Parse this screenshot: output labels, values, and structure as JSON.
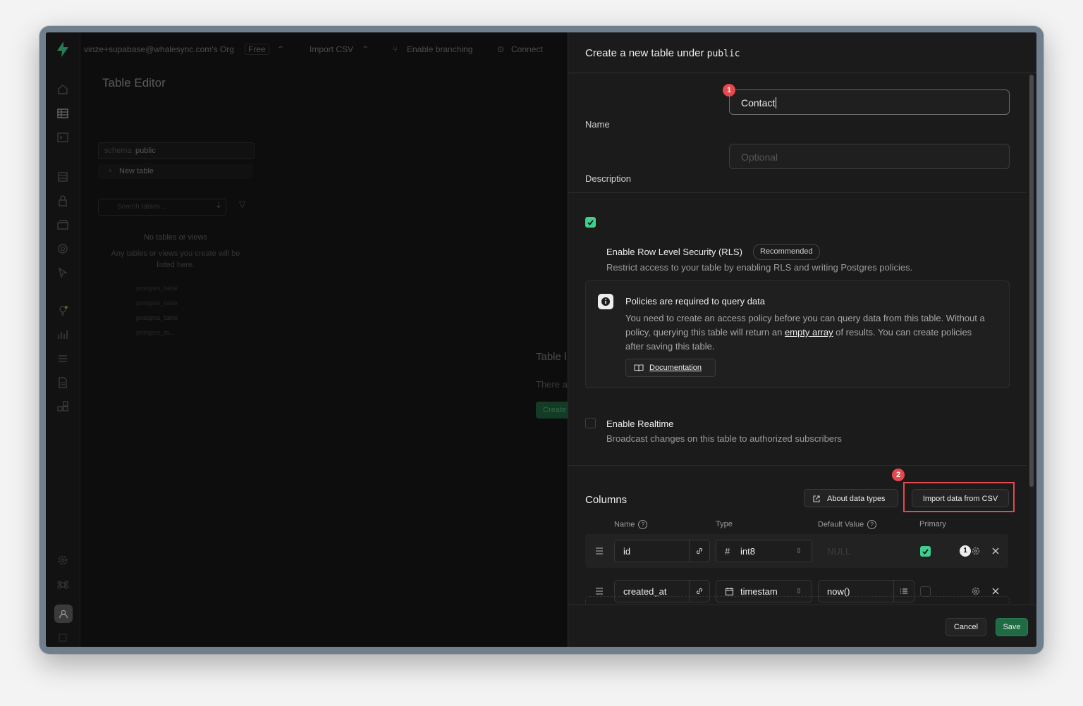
{
  "topbar": {
    "org": "vinze+supabase@whalesync.com's Org",
    "plan": "Free",
    "project": "Import CSV",
    "branching": "Enable branching",
    "connect": "Connect"
  },
  "left": {
    "title": "Table Editor",
    "schema_label": "schema",
    "schema_value": "public",
    "new_table": "New table",
    "search_placeholder": "Search tables...",
    "empty_title": "No tables or views",
    "empty_desc": "Any tables or views you create will be listed here.",
    "ghost_items": [
      "postgres_table",
      "postgres_table",
      "postgres_table",
      "postgres_ta..."
    ]
  },
  "center": {
    "title": "Table l",
    "subtitle": "There a",
    "button": "Create"
  },
  "panel": {
    "title_prefix": "Create a new table under",
    "schema": "public",
    "name_label": "Name",
    "name_value": "Contact",
    "description_label": "Description",
    "description_placeholder": "Optional",
    "rls": {
      "title": "Enable Row Level Security (RLS)",
      "badge": "Recommended",
      "desc": "Restrict access to your table by enabling RLS and writing Postgres policies.",
      "checked": true
    },
    "alert": {
      "title": "Policies are required to query data",
      "body_1": "You need to create an access policy before you can query data from this table. Without a policy, querying this table will return an",
      "link": "empty array",
      "body_2": "of results. You can create policies after saving this table.",
      "doc_button": "Documentation"
    },
    "realtime": {
      "title": "Enable Realtime",
      "desc": "Broadcast changes on this table to authorized subscribers",
      "checked": false
    },
    "columns": {
      "title": "Columns",
      "about_button": "About data types",
      "import_button": "Import data from CSV",
      "headers": {
        "name": "Name",
        "type": "Type",
        "default": "Default Value",
        "primary": "Primary"
      },
      "rows": [
        {
          "name": "id",
          "type_icon": "hash-icon",
          "type": "int8",
          "default": "NULL",
          "primary": true
        },
        {
          "name": "created_at",
          "type_icon": "calendar-icon",
          "type": "timestam",
          "default": "now()",
          "primary": false
        }
      ]
    },
    "footer": {
      "cancel": "Cancel",
      "save": "Save"
    }
  },
  "markers": [
    "1",
    "2",
    "1"
  ],
  "colors": {
    "accent": "#3ecf8e",
    "save": "#1f6b43",
    "highlight": "#e5484d"
  }
}
